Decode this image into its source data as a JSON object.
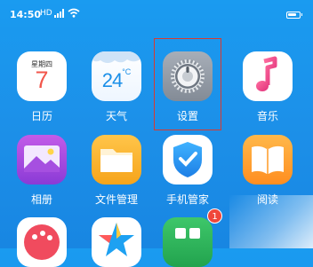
{
  "status_bar": {
    "time": "14:50",
    "signal_text": "HD",
    "battery_percent": 80
  },
  "apps": {
    "calendar": {
      "label": "日历",
      "weekday": "星期四",
      "day": "7"
    },
    "weather": {
      "label": "天气",
      "temperature": "24",
      "unit": "°C"
    },
    "settings": {
      "label": "设置"
    },
    "music": {
      "label": "音乐"
    },
    "gallery": {
      "label": "相册"
    },
    "files": {
      "label": "文件管理"
    },
    "phone_manager": {
      "label": "手机管家"
    },
    "reading": {
      "label": "阅读"
    },
    "green_app": {
      "badge": "1"
    }
  },
  "colors": {
    "background": "#1a9bf0",
    "highlight": "#d93a2f",
    "badge": "#f0463a",
    "calendar_day": "#f2564b"
  }
}
